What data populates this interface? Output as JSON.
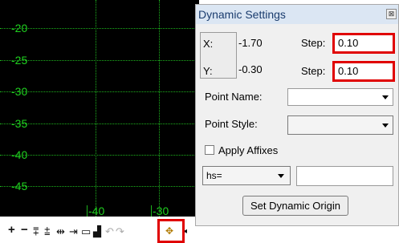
{
  "plot": {
    "y_labels": [
      "-20",
      "-25",
      "-30",
      "-35",
      "-40",
      "-45"
    ],
    "x_labels": [
      "-40",
      "-30"
    ],
    "grid_color": "#1db11d",
    "label_color": "#1fd11f",
    "background": "#000000"
  },
  "toolbar": {
    "icons": [
      "plus-icon",
      "minus-icon",
      "align-icon",
      "align2-icon",
      "move-h-icon",
      "move-h2-icon",
      "rect-icon",
      "chart-icon",
      "undo-icon",
      "redo-icon",
      "dynamic-point-icon",
      "expand-icon"
    ]
  },
  "dialog": {
    "title": "Dynamic Settings",
    "close_label": "⊠",
    "x_label": "X:",
    "x_value": "-1.70",
    "y_label": "Y:",
    "y_value": "-0.30",
    "step_label": "Step:",
    "x_step": "0.10",
    "y_step": "0.10",
    "point_name_label": "Point Name:",
    "point_name_value": "",
    "point_style_label": "Point Style:",
    "point_style_value": "",
    "apply_affixes_label": "Apply Affixes",
    "apply_affixes_checked": false,
    "affix_select_value": "hs=",
    "affix_input_value": "",
    "set_origin_label": "Set Dynamic Origin",
    "highlight_color": "#e00000"
  }
}
